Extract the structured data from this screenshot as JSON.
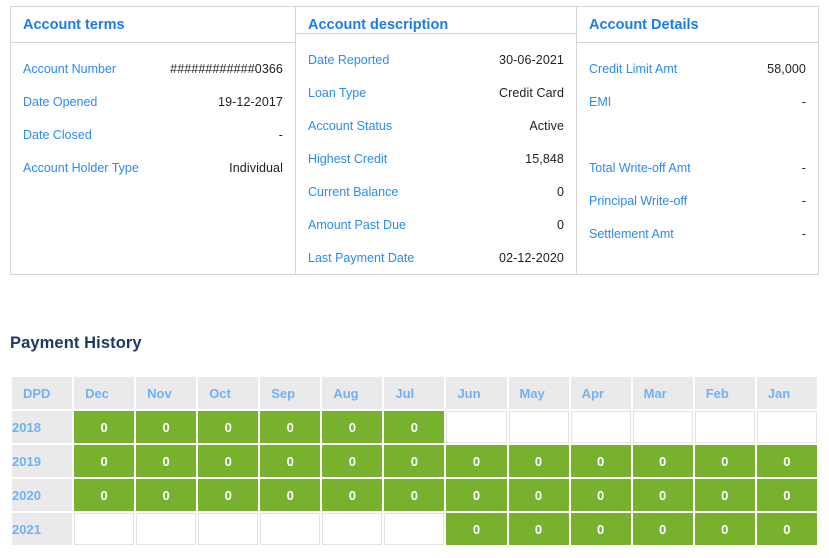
{
  "colors": {
    "accent_blue": "#1a7cf0",
    "label_blue": "#2a8bf2",
    "header_blue": "#70b2f7",
    "title_navy": "#1f3864",
    "green": "#76b22d",
    "header_gray": "#eaeaea",
    "border_gray": "#d5d5d5"
  },
  "info_card": {
    "columns": [
      {
        "title": "Account terms",
        "rows": [
          {
            "label": "Account Number",
            "value": "############0366"
          },
          {
            "label": "Date Opened",
            "value": "19-12-2017"
          },
          {
            "label": "Date Closed",
            "value": "-"
          },
          {
            "label": "Account Holder Type",
            "value": "Individual"
          }
        ]
      },
      {
        "title": "Account description",
        "rows": [
          {
            "label": "Date Reported",
            "value": "30-06-2021"
          },
          {
            "label": "Loan Type",
            "value": "Credit Card"
          },
          {
            "label": "Account Status",
            "value": "Active"
          },
          {
            "label": "Highest Credit",
            "value": "15,848"
          },
          {
            "label": "Current Balance",
            "value": "0"
          },
          {
            "label": "Amount Past Due",
            "value": "0"
          },
          {
            "label": "Last Payment Date",
            "value": "02-12-2020"
          }
        ]
      },
      {
        "title": "Account Details",
        "rows": [
          {
            "label": "Credit Limit Amt",
            "value": "58,000"
          },
          {
            "label": "EMI",
            "value": "-"
          },
          {
            "label": "",
            "value": "",
            "blank": true
          },
          {
            "label": "Total Write-off Amt",
            "value": "-"
          },
          {
            "label": "Principal Write-off",
            "value": "-"
          },
          {
            "label": "Settlement Amt",
            "value": "-"
          }
        ]
      }
    ]
  },
  "payment_history": {
    "title": "Payment History",
    "columns": [
      "DPD",
      "Dec",
      "Nov",
      "Oct",
      "Sep",
      "Aug",
      "Jul",
      "Jun",
      "May",
      "Apr",
      "Mar",
      "Feb",
      "Jan"
    ],
    "rows": [
      {
        "year": "2018",
        "values": [
          "0",
          "0",
          "0",
          "0",
          "0",
          "0",
          "",
          "",
          "",
          "",
          "",
          ""
        ]
      },
      {
        "year": "2019",
        "values": [
          "0",
          "0",
          "0",
          "0",
          "0",
          "0",
          "0",
          "0",
          "0",
          "0",
          "0",
          "0"
        ]
      },
      {
        "year": "2020",
        "values": [
          "0",
          "0",
          "0",
          "0",
          "0",
          "0",
          "0",
          "0",
          "0",
          "0",
          "0",
          "0"
        ]
      },
      {
        "year": "2021",
        "values": [
          "",
          "",
          "",
          "",
          "",
          "",
          "0",
          "0",
          "0",
          "0",
          "0",
          "0"
        ]
      }
    ]
  }
}
